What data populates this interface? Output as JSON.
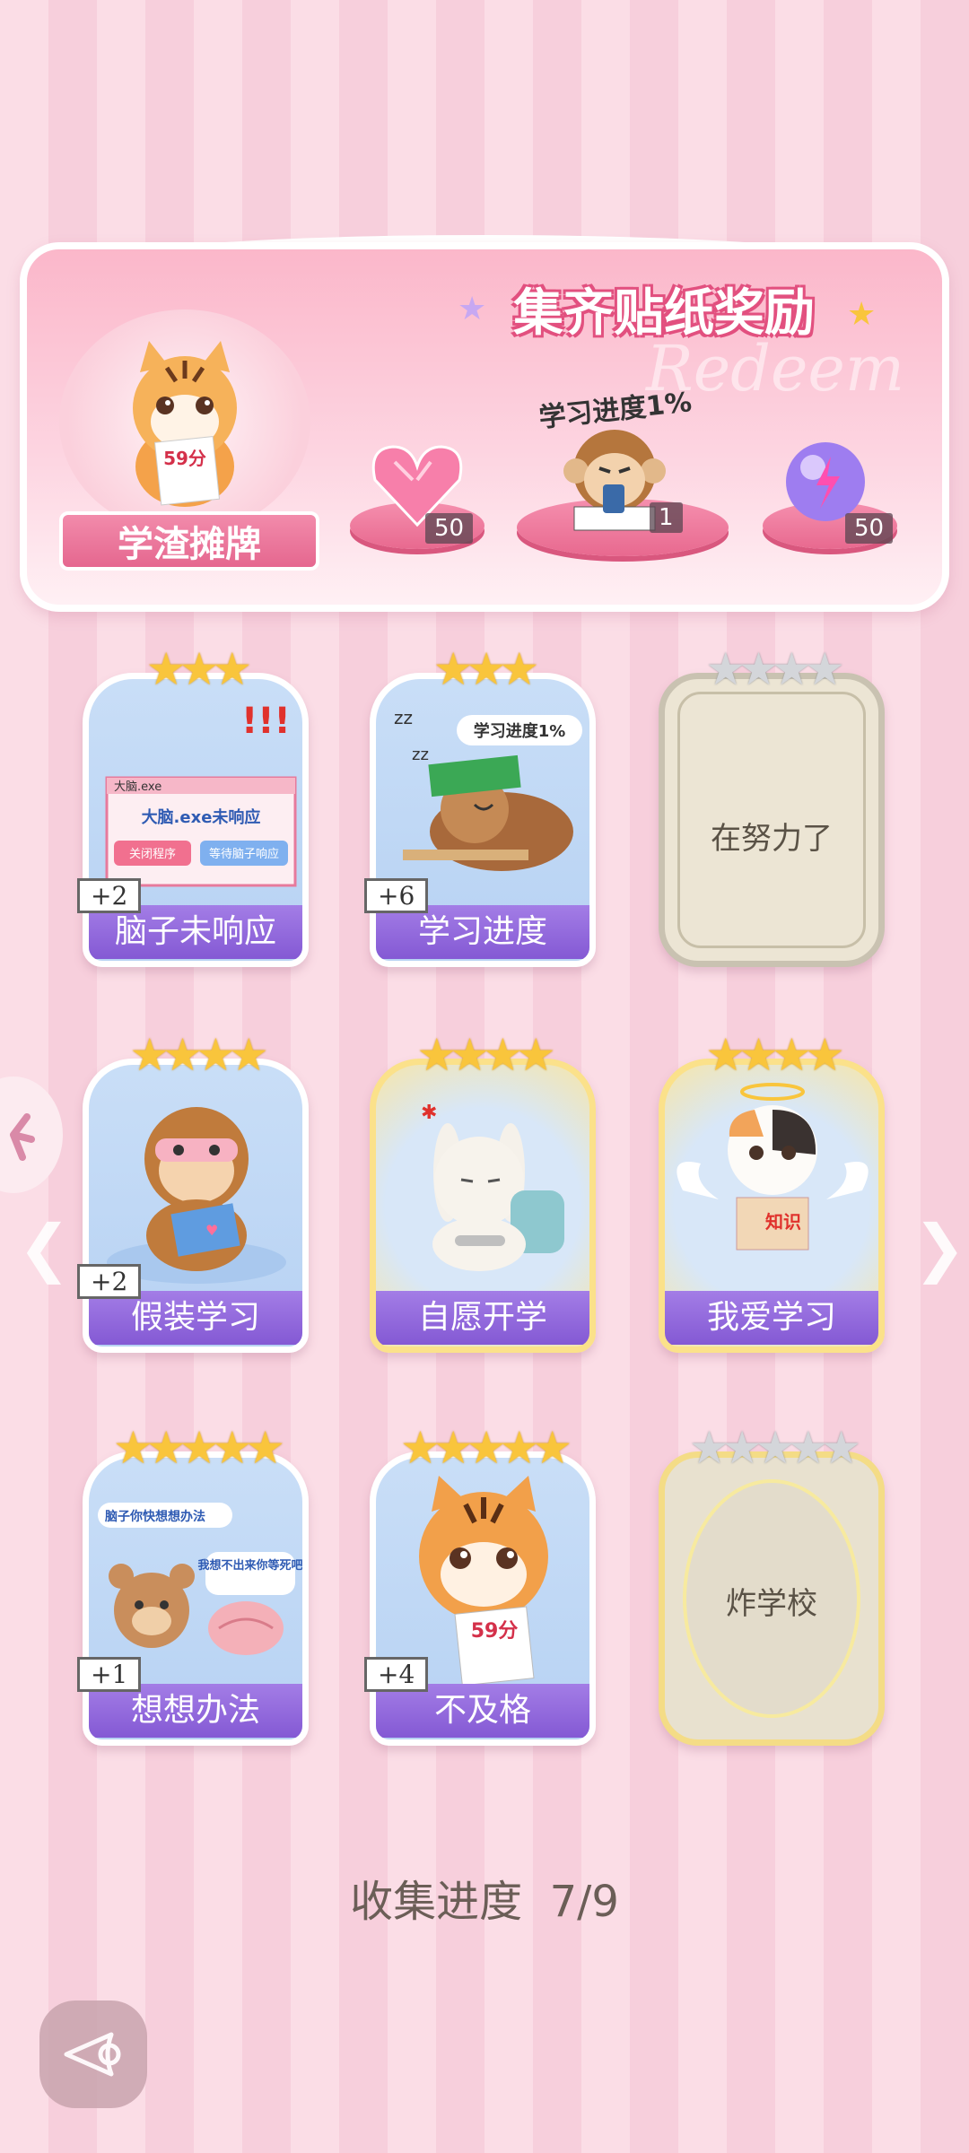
{
  "banner": {
    "title": "集齐贴纸奖励",
    "subtitle_watermark": "Redeem",
    "progress_bubble": "学习进度1%",
    "nameplate": "学渣摊牌",
    "avatar_sign": "59分",
    "rewards": [
      {
        "name": "heart-gem",
        "count": "50"
      },
      {
        "name": "monkey-sticker",
        "count": "1"
      },
      {
        "name": "energy-orb",
        "count": "50"
      }
    ]
  },
  "cards": [
    {
      "label": "脑子未响应",
      "plus": "+2",
      "stars_on": 3,
      "stars_total": 3,
      "state": "unlocked",
      "art_text": "大脑.exe未响应",
      "art_buttons": [
        "关闭程序",
        "等待脑子响应"
      ],
      "window_title": "大脑.exe"
    },
    {
      "label": "学习进度",
      "plus": "+6",
      "stars_on": 3,
      "stars_total": 3,
      "state": "unlocked",
      "art_text": "学习进度1%"
    },
    {
      "label": "",
      "plus": "",
      "stars_on": 0,
      "stars_total": 4,
      "state": "locked",
      "locked_text": "在努力了"
    },
    {
      "label": "假装学习",
      "plus": "+2",
      "stars_on": 4,
      "stars_total": 4,
      "state": "unlocked"
    },
    {
      "label": "自愿开学",
      "plus": "",
      "stars_on": 4,
      "stars_total": 4,
      "state": "gold"
    },
    {
      "label": "我爱学习",
      "plus": "",
      "stars_on": 4,
      "stars_total": 4,
      "state": "gold",
      "art_text": "知识"
    },
    {
      "label": "想想办法",
      "plus": "+1",
      "stars_on": 5,
      "stars_total": 5,
      "state": "unlocked",
      "art_text": "脑子你快想想办法",
      "art_text2": "我想不出来你等死吧"
    },
    {
      "label": "不及格",
      "plus": "+4",
      "stars_on": 5,
      "stars_total": 5,
      "state": "unlocked",
      "art_text": "59分"
    },
    {
      "label": "",
      "plus": "",
      "stars_on": 0,
      "stars_total": 5,
      "state": "locked-gold",
      "locked_text": "炸学校"
    }
  ],
  "progress": {
    "label": "收集进度",
    "value": "7/9"
  },
  "colors": {
    "accent": "#8459d4",
    "star": "#f9c53c",
    "pink": "#e8698f"
  }
}
